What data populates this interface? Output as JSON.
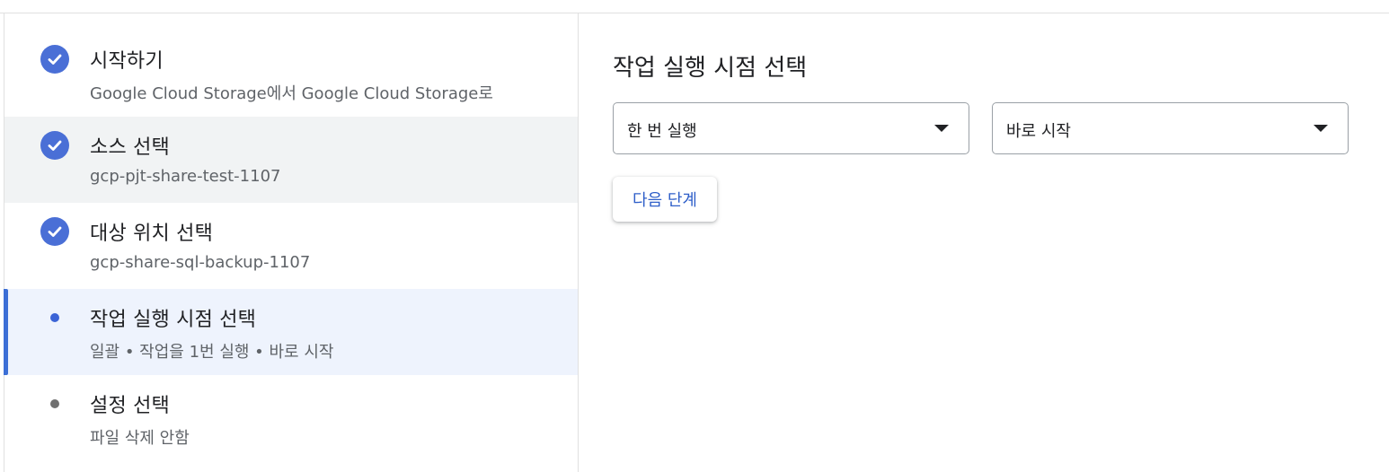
{
  "steps": [
    {
      "title": "시작하기",
      "subtitle": "Google Cloud Storage에서 Google Cloud Storage로",
      "state": "completed"
    },
    {
      "title": "소스 선택",
      "subtitle": "gcp-pjt-share-test-1107",
      "state": "completed"
    },
    {
      "title": "대상 위치 선택",
      "subtitle": "gcp-share-sql-backup-1107",
      "state": "completed"
    },
    {
      "title": "작업 실행 시점 선택",
      "subtitle": "일괄 • 작업을 1번 실행 • 바로 시작",
      "state": "active"
    },
    {
      "title": "설정 선택",
      "subtitle": "파일 삭제 안함",
      "state": "pending"
    }
  ],
  "panel": {
    "title": "작업 실행 시점 선택",
    "run_frequency_select": {
      "value": "한 번 실행"
    },
    "start_time_select": {
      "value": "바로 시작"
    },
    "next_button_label": "다음 단계"
  },
  "colors": {
    "accent": "#4a6fd6",
    "active_bg": "#eef3fd",
    "completed_bg": "#f1f3f4",
    "button_text": "#2f5fc9"
  }
}
